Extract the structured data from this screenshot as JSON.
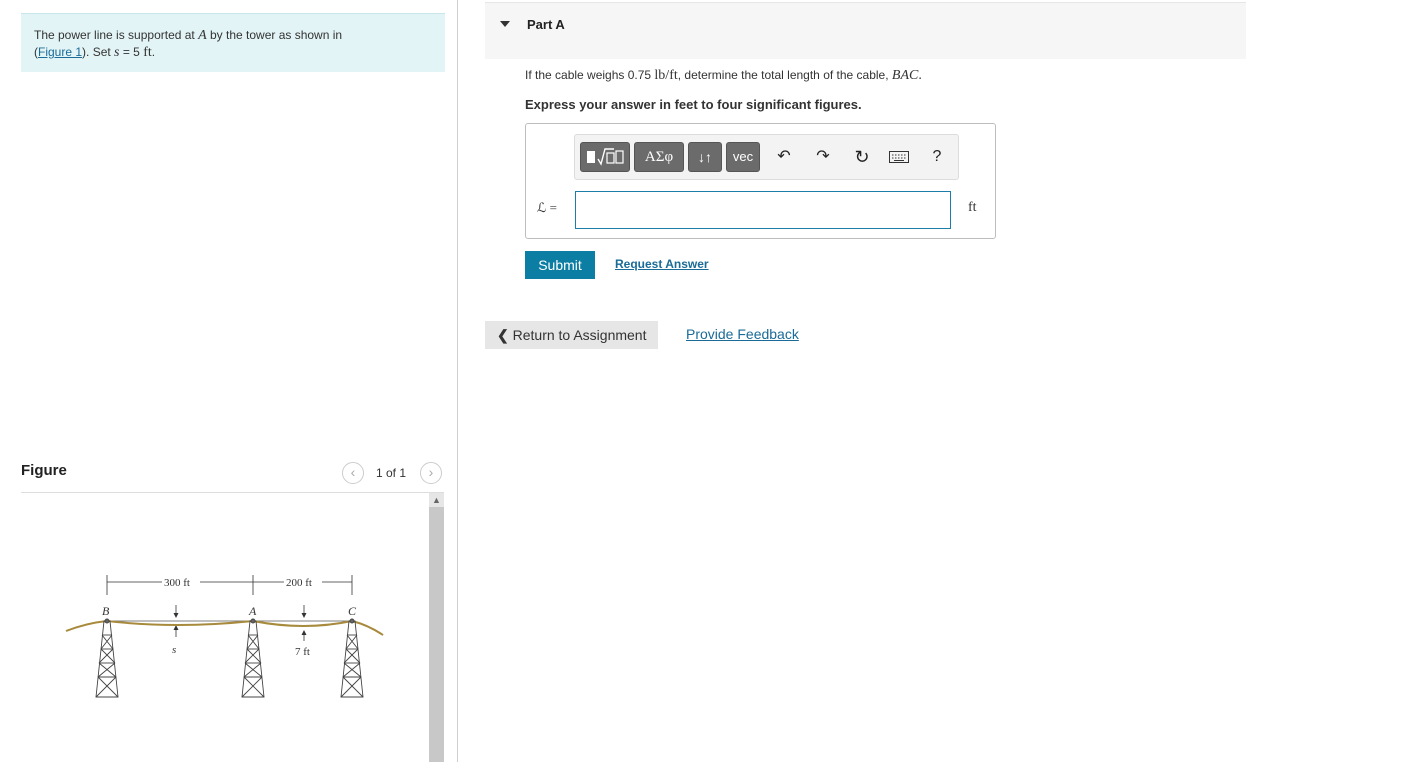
{
  "problem": {
    "text_pre": "The power line is supported at ",
    "point": "A",
    "text_mid": " by the tower as shown in",
    "open_paren": "(",
    "figure_link": "Figure 1",
    "after_link": "). Set ",
    "s_var": "s",
    "s_value": " = 5 ",
    "s_unit": "ft",
    "s_end": "."
  },
  "figure_panel": {
    "title": "Figure",
    "counter": "1 of 1",
    "prev_icon": "chevron-left-icon",
    "next_icon": "chevron-right-icon",
    "labels": {
      "span1": "300 ft",
      "span2": "200 ft",
      "B": "B",
      "A": "A",
      "C": "C",
      "s": "s",
      "sag": "7 ft"
    }
  },
  "part": {
    "title": "Part A",
    "question_pre": "If the cable weighs 0.75 ",
    "question_unit": "lb/ft",
    "question_mid": ", determine the total length of the cable, ",
    "question_var": "BAC",
    "question_end": ".",
    "instruction": "Express your answer in feet to four significant figures."
  },
  "toolbar": {
    "template_btn": "template-sqrt-icon",
    "greek_btn": "ΑΣφ",
    "sort_btn": "↓↑",
    "vec_btn": "vec",
    "undo_icon": "undo-icon",
    "redo_icon": "redo-icon",
    "reset_icon": "reset-icon",
    "keyboard_icon": "keyboard-icon",
    "help_label": "?"
  },
  "answer": {
    "label": "ℒ =",
    "value": "",
    "unit": "ft"
  },
  "actions": {
    "submit": "Submit",
    "request_answer": "Request Answer",
    "return": "Return to Assignment",
    "feedback": "Provide Feedback"
  },
  "colors": {
    "problem_bg": "#e3f4f6",
    "accent": "#0d7ea3",
    "link": "#1a6b97",
    "cable": "#a78a3c"
  }
}
